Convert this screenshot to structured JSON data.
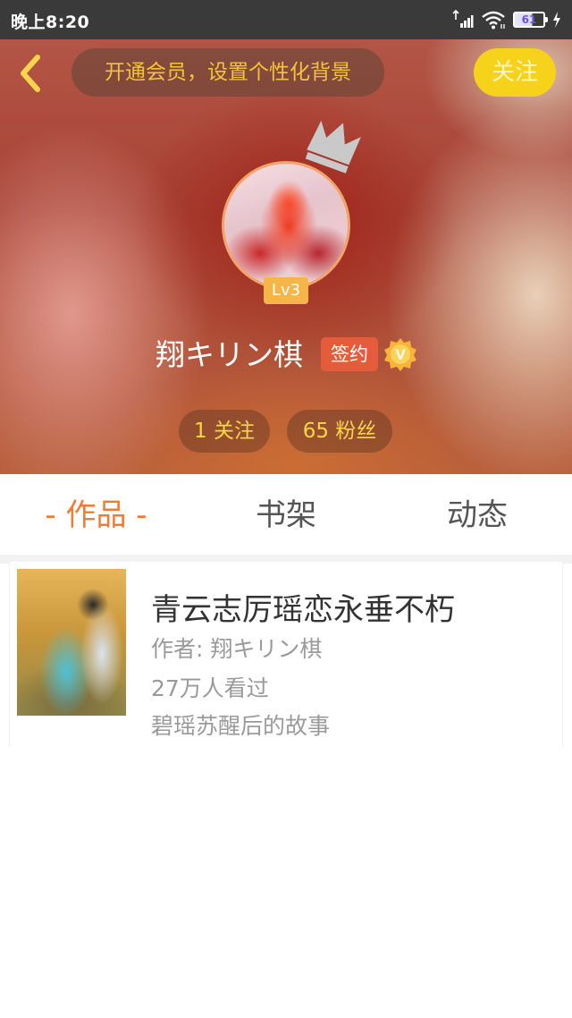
{
  "status_bar": {
    "time": "晚上8:20",
    "battery_level": "61",
    "icons": [
      "signal-icon",
      "wifi-icon",
      "battery-icon",
      "charging-icon"
    ]
  },
  "header": {
    "back_icon": "chevron-left-icon",
    "vip_banner": "开通会员，设置个性化背景",
    "follow_label": "关注",
    "accent_color": "#f7d21a"
  },
  "profile": {
    "level": "Lv3",
    "username": "翔キリン棋",
    "signed_label": "签约",
    "verified_badge_letter": "V",
    "following": "1 关注",
    "fans": "65 粉丝"
  },
  "tabs": [
    {
      "label": "- 作品 -",
      "active": true
    },
    {
      "label": "书架",
      "active": false
    },
    {
      "label": "动态",
      "active": false
    }
  ],
  "works": [
    {
      "title": "青云志厉瑶恋永垂不朽",
      "author": "作者: 翔キリン棋",
      "views": "27万人看过",
      "description": "碧瑶苏醒后的故事"
    }
  ],
  "colors": {
    "active_tab": "#ef7b35",
    "signed_badge": "#e45c3c",
    "level_badge": "#f5b547"
  }
}
